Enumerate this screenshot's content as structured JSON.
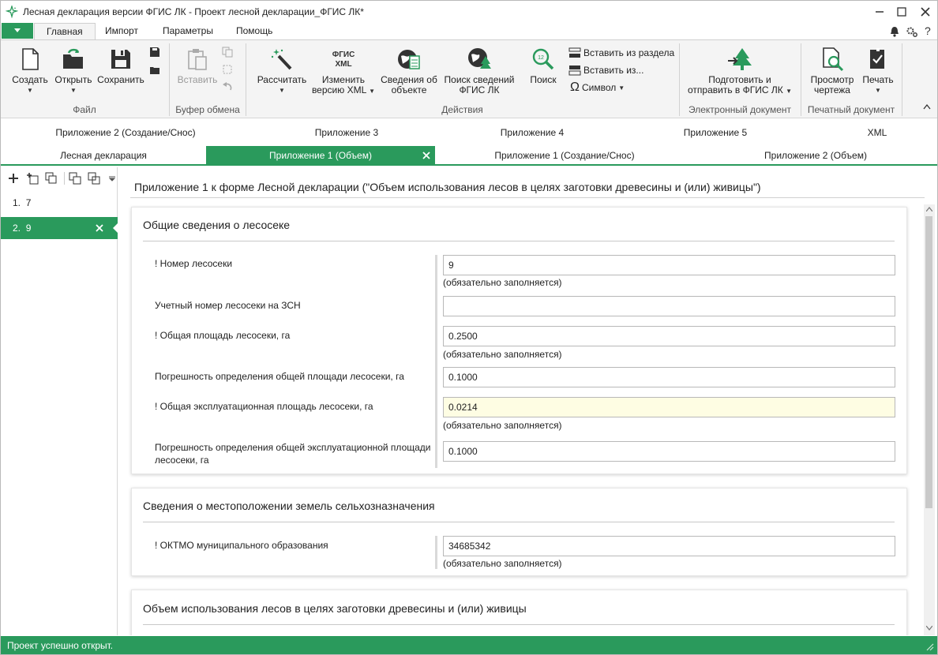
{
  "window": {
    "title": "Лесная декларация версии ФГИС ЛК - Проект лесной декларации_ФГИС ЛК*",
    "controls": [
      "minimize-icon",
      "maximize-icon",
      "close-icon"
    ]
  },
  "ribbon_tabs": [
    "Главная",
    "Импорт",
    "Параметры",
    "Помощь"
  ],
  "ribbon": {
    "groups": {
      "file": "Файл",
      "clipboard": "Буфер обмена",
      "actions": "Действия",
      "edoc": "Электронный документ",
      "print": "Печатный документ"
    },
    "buttons": {
      "create": "Создать",
      "open": "Открыть",
      "save": "Сохранить",
      "paste": "Вставить",
      "calc": "Рассчитать",
      "xml_logo": "ФГИС\nXML",
      "change_xml_1": "Изменить",
      "change_xml_2": "версию XML",
      "object_info_1": "Сведения об",
      "object_info_2": "объекте",
      "fgis_search_1": "Поиск сведений",
      "fgis_search_2": "ФГИС ЛК",
      "search": "Поиск",
      "insert_from_section": "Вставить из раздела",
      "insert_from": "Вставить из...",
      "symbol": "Символ",
      "prepare_send_1": "Подготовить и",
      "prepare_send_2": "отправить в ФГИС ЛК",
      "preview_1": "Просмотр",
      "preview_2": "чертежа",
      "print": "Печать"
    }
  },
  "doc_tabs": {
    "row1": [
      "Приложение 2 (Создание/Снос)",
      "Приложение 3",
      "Приложение 4",
      "Приложение 5",
      "XML"
    ],
    "row2": [
      "Лесная декларация",
      "Приложение 1 (Объем)",
      "Приложение 1 (Создание/Снос)",
      "Приложение 2 (Объем)"
    ],
    "active": "Приложение 1 (Объем)"
  },
  "sidebar": {
    "items": [
      {
        "num": "1.",
        "label": "7"
      },
      {
        "num": "2.",
        "label": "9"
      }
    ],
    "active_index": 1
  },
  "form": {
    "title": "Приложение 1 к форме Лесной декларации (\"Объем использования лесов в целях заготовки древесины и (или) живицы\")",
    "sections": [
      {
        "title": "Общие сведения о лесосеке",
        "fields": [
          {
            "label": "! Номер лесосеки",
            "value": "9",
            "hint": "(обязательно заполняется)"
          },
          {
            "label": "Учетный номер лесосеки на ЗСН",
            "value": "",
            "hint": ""
          },
          {
            "label": "! Общая площадь лесосеки, га",
            "value": "0.2500",
            "hint": "(обязательно заполняется)"
          },
          {
            "label": "Погрешность определения общей площади лесосеки, га",
            "value": "0.1000",
            "hint": ""
          },
          {
            "label": "! Общая эксплуатационная площадь лесосеки, га",
            "value": "0.0214",
            "hint": "(обязательно заполняется)"
          },
          {
            "label": "Погрешность определения общей эксплуатационной площади лесосеки, га",
            "value": "0.1000",
            "hint": ""
          }
        ]
      },
      {
        "title": "Сведения о местоположении земель сельхозназначения",
        "fields": [
          {
            "label": "! ОКТМО муниципального образования",
            "value": "34685342",
            "hint": "(обязательно заполняется)"
          }
        ]
      },
      {
        "title": "Объем использования лесов в целях заготовки древесины и (или) живицы",
        "fields": []
      }
    ]
  },
  "status": "Проект успешно открыт.",
  "colors": {
    "accent": "#2a9a5c",
    "highlight_input": "#fefde3"
  }
}
